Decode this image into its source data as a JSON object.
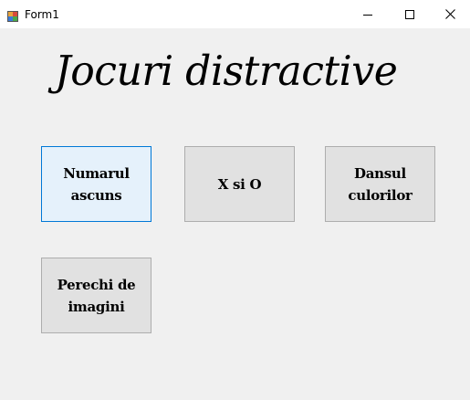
{
  "window": {
    "title": "Form1"
  },
  "icons": {
    "app": "form-app-icon",
    "minimize": "minimize-icon",
    "maximize": "maximize-icon",
    "close": "close-icon"
  },
  "main": {
    "heading": "Jocuri distractive",
    "buttons": [
      {
        "label": "Numarul ascuns",
        "focused": true
      },
      {
        "label": "X si O",
        "focused": false
      },
      {
        "label": "Dansul culorilor",
        "focused": false
      },
      {
        "label": "Perechi de imagini",
        "focused": false
      }
    ]
  },
  "colors": {
    "background": "#f0f0f0",
    "button_face": "#e1e1e1",
    "button_border": "#adadad",
    "focus_border": "#0078d7",
    "focus_face": "#e5f1fb"
  }
}
